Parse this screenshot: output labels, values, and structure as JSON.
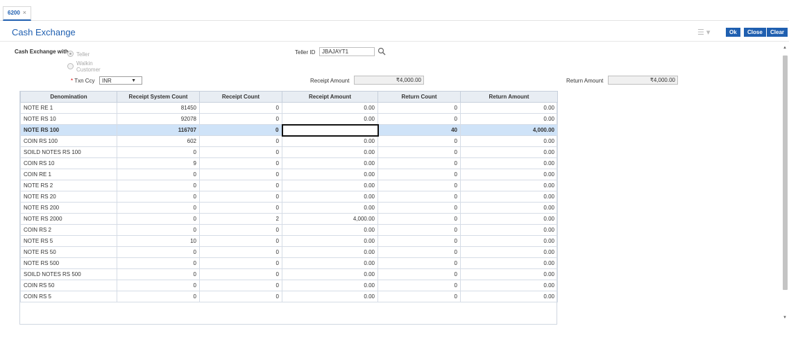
{
  "tab": {
    "label": "6200",
    "close": "×"
  },
  "header": {
    "title": "Cash Exchange",
    "ok_label": "Ok",
    "close_label": "Close",
    "clear_label": "Clear",
    "menu_icon": "menu-icon"
  },
  "form": {
    "cash_exchange_with_label": "Cash Exchange with",
    "option_teller": "Teller",
    "option_walkin_line1": "Walkin",
    "option_walkin_line2": "Customer",
    "teller_id_label": "Teller ID",
    "teller_id_value": "JBAJAYT1",
    "txn_ccy_required": "*",
    "txn_ccy_label": "Txn Ccy",
    "txn_ccy_value": "INR",
    "receipt_amount_label": "Receipt Amount",
    "receipt_amount_value": "₹4,000.00",
    "return_amount_label": "Return Amount",
    "return_amount_value": "₹4,000.00"
  },
  "table": {
    "columns": [
      "Denomination",
      "Receipt System Count",
      "Receipt Count",
      "Receipt Amount",
      "Return Count",
      "Return Amount"
    ],
    "rows": [
      [
        "NOTE RE 1",
        "81450",
        "0",
        "0.00",
        "0",
        "0.00"
      ],
      [
        "NOTE RS 10",
        "92078",
        "0",
        "0.00",
        "0",
        "0.00"
      ],
      [
        "NOTE RS 100",
        "116707",
        "0",
        "",
        "40",
        "4,000.00"
      ],
      [
        "COIN RS 100",
        "602",
        "0",
        "0.00",
        "0",
        "0.00"
      ],
      [
        "SOILD NOTES RS 100",
        "0",
        "0",
        "0.00",
        "0",
        "0.00"
      ],
      [
        "COIN RS 10",
        "9",
        "0",
        "0.00",
        "0",
        "0.00"
      ],
      [
        "COIN RE 1",
        "0",
        "0",
        "0.00",
        "0",
        "0.00"
      ],
      [
        "NOTE RS 2",
        "0",
        "0",
        "0.00",
        "0",
        "0.00"
      ],
      [
        "NOTE RS 20",
        "0",
        "0",
        "0.00",
        "0",
        "0.00"
      ],
      [
        "NOTE RS 200",
        "0",
        "0",
        "0.00",
        "0",
        "0.00"
      ],
      [
        "NOTE RS 2000",
        "0",
        "2",
        "4,000.00",
        "0",
        "0.00"
      ],
      [
        "COIN RS 2",
        "0",
        "0",
        "0.00",
        "0",
        "0.00"
      ],
      [
        "NOTE RS 5",
        "10",
        "0",
        "0.00",
        "0",
        "0.00"
      ],
      [
        "NOTE RS 50",
        "0",
        "0",
        "0.00",
        "0",
        "0.00"
      ],
      [
        "NOTE RS 500",
        "0",
        "0",
        "0.00",
        "0",
        "0.00"
      ],
      [
        "SOILD NOTES RS 500",
        "0",
        "0",
        "0.00",
        "0",
        "0.00"
      ],
      [
        "COIN RS 50",
        "0",
        "0",
        "0.00",
        "0",
        "0.00"
      ],
      [
        "COIN RS 5",
        "0",
        "0",
        "0.00",
        "0",
        "0.00"
      ]
    ],
    "selected_row": 2
  },
  "colors": {
    "accent": "#1f5fb0",
    "selected_row": "#cfe3f8"
  }
}
